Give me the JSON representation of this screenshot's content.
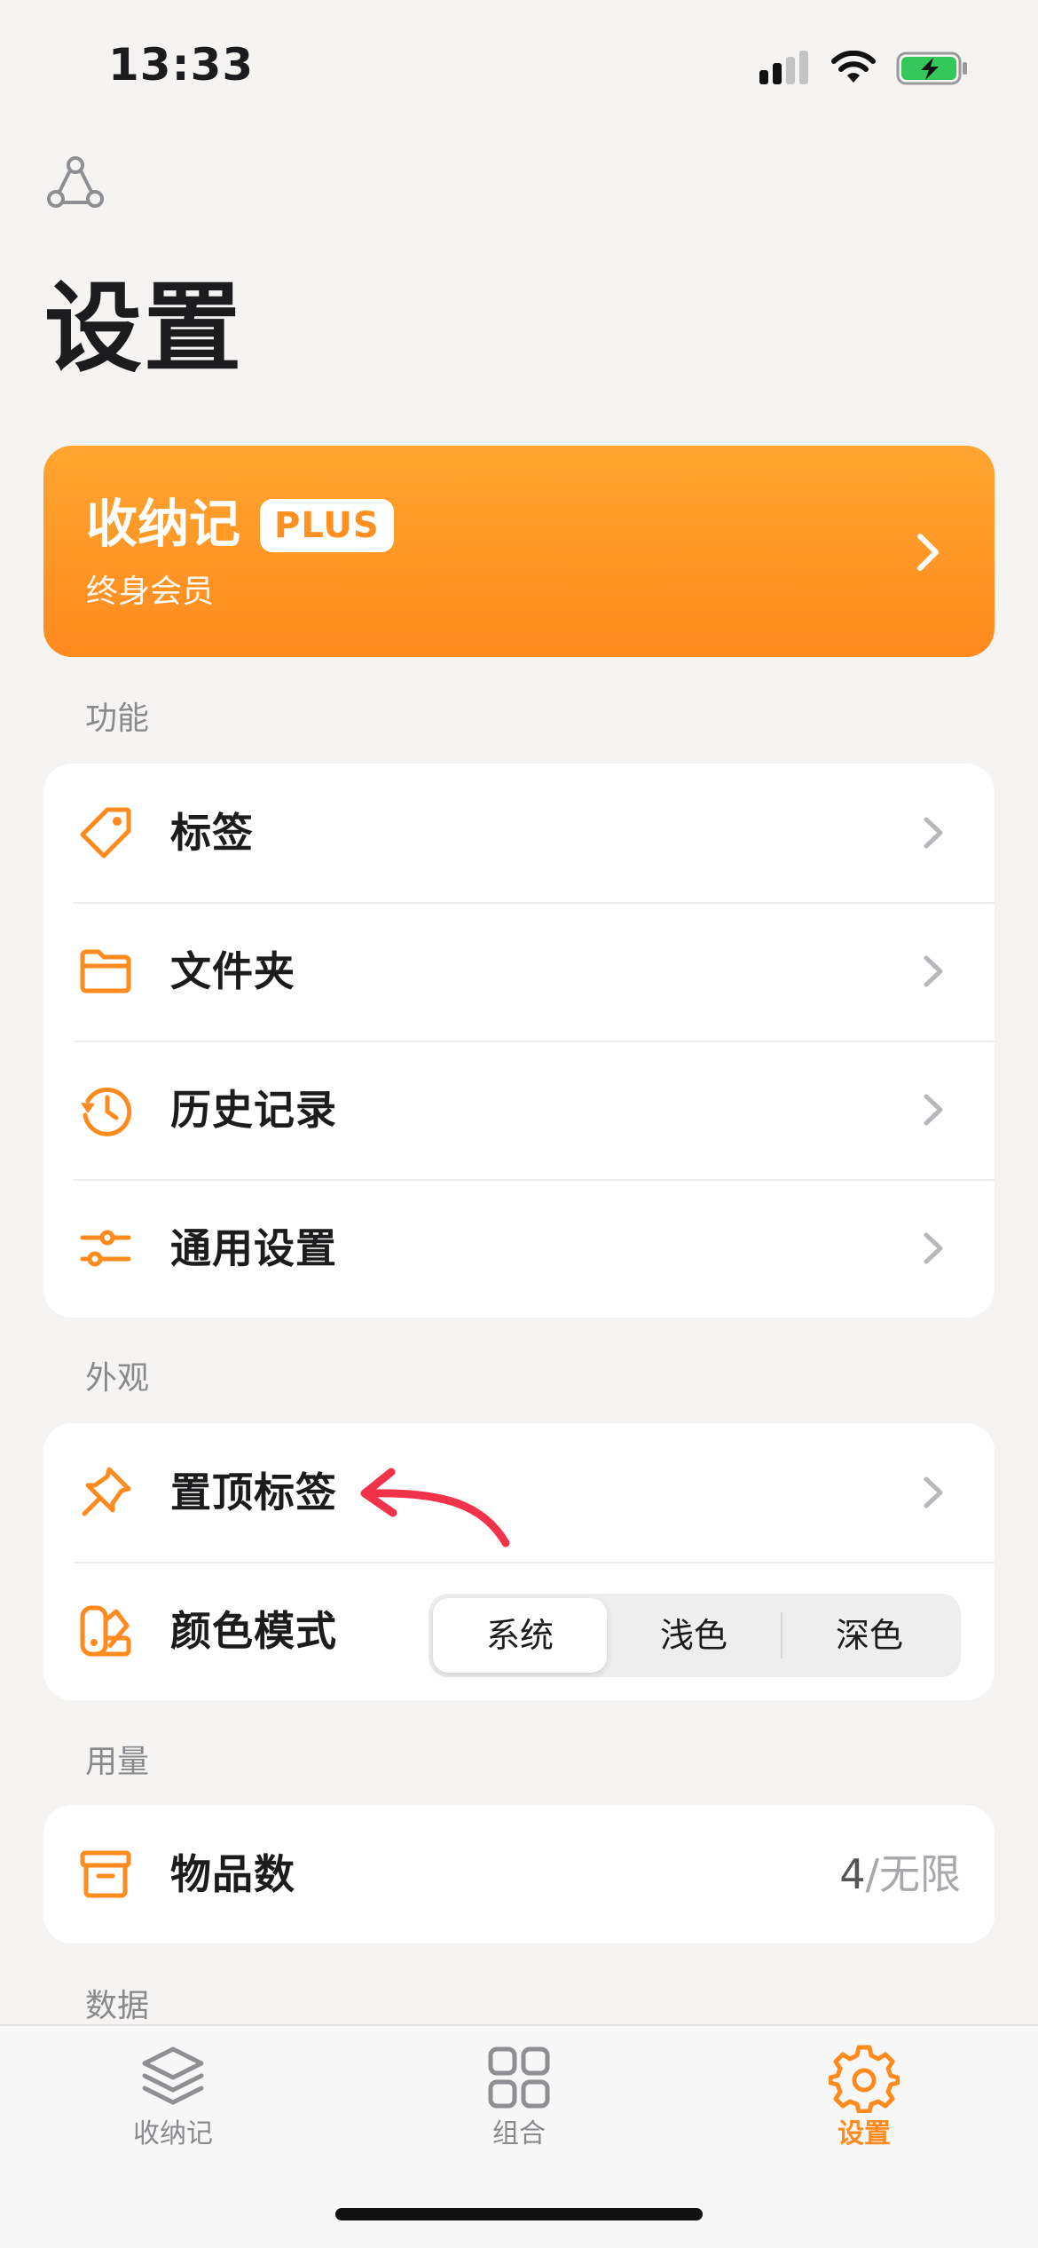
{
  "status_bar": {
    "time": "13:33"
  },
  "page": {
    "title": "设置"
  },
  "plus_banner": {
    "title": "收纳记",
    "badge": "PLUS",
    "subtitle": "终身会员"
  },
  "sections": {
    "features": {
      "label": "功能",
      "items": [
        {
          "label": "标签",
          "icon": "tag-icon"
        },
        {
          "label": "文件夹",
          "icon": "folder-icon"
        },
        {
          "label": "历史记录",
          "icon": "history-icon"
        },
        {
          "label": "通用设置",
          "icon": "sliders-icon"
        }
      ]
    },
    "appearance": {
      "label": "外观",
      "pinned_tags": {
        "label": "置顶标签",
        "icon": "pin-icon"
      },
      "color_mode": {
        "label": "颜色模式",
        "icon": "palette-icon",
        "options": [
          "系统",
          "浅色",
          "深色"
        ],
        "selected": "系统"
      }
    },
    "usage": {
      "label": "用量",
      "item_count": {
        "label": "物品数",
        "used": "4",
        "separator": "/",
        "limit": "无限",
        "icon": "box-icon"
      }
    },
    "data": {
      "label": "数据"
    }
  },
  "tab_bar": {
    "tabs": [
      {
        "label": "收纳记",
        "icon": "layers-icon",
        "active": false
      },
      {
        "label": "组合",
        "icon": "grid-icon",
        "active": false
      },
      {
        "label": "设置",
        "icon": "gear-icon",
        "active": true
      }
    ]
  },
  "colors": {
    "accent": "#ff8a1e",
    "annotation": "#f0334a",
    "background": "#f5f4f2"
  }
}
